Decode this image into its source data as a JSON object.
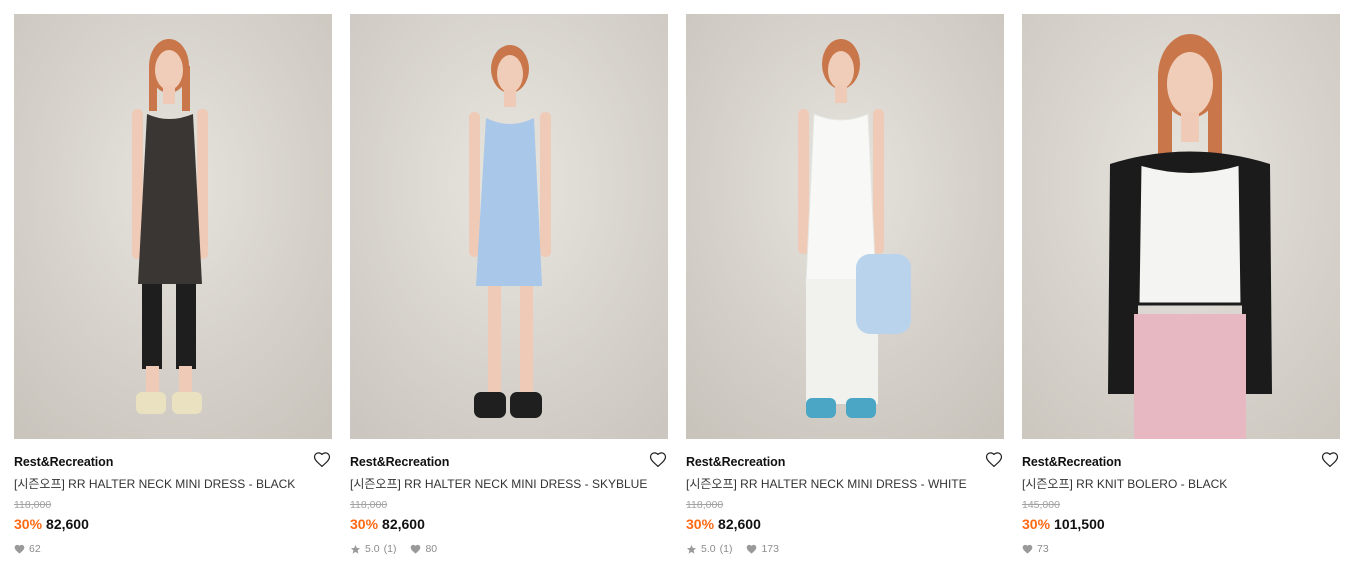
{
  "products": [
    {
      "brand": "Rest&Recreation",
      "name": "[시즌오프] RR HALTER NECK MINI DRESS - BLACK",
      "original_price": "118,000",
      "discount": "30%",
      "price": "82,600",
      "rating": "",
      "review_count": "",
      "likes": "62",
      "colors": {
        "garment": "#3a3633",
        "legs": "#1e1e1e",
        "shoes": "#e9e1bf"
      }
    },
    {
      "brand": "Rest&Recreation",
      "name": "[시즌오프] RR HALTER NECK MINI DRESS - SKYBLUE",
      "original_price": "118,000",
      "discount": "30%",
      "price": "82,600",
      "rating": "5.0",
      "review_count": "(1)",
      "likes": "80",
      "colors": {
        "garment": "#a9c7e8",
        "legs": "#e9c5b2",
        "shoes": "#1f1f1f"
      }
    },
    {
      "brand": "Rest&Recreation",
      "name": "[시즌오프] RR HALTER NECK MINI DRESS - WHITE",
      "original_price": "118,000",
      "discount": "30%",
      "price": "82,600",
      "rating": "5.0",
      "review_count": "(1)",
      "likes": "173",
      "colors": {
        "garment": "#f8f8f6",
        "legs": "#f1f1ee",
        "shoes": "#4aa6c4"
      }
    },
    {
      "brand": "Rest&Recreation",
      "name": "[시즌오프] RR KNIT BOLERO - BLACK",
      "original_price": "145,000",
      "discount": "30%",
      "price": "101,500",
      "rating": "",
      "review_count": "",
      "likes": "73",
      "colors": {
        "garment": "#1b1b1b",
        "legs": "#e8b8c2",
        "shoes": "#f4f4f2"
      }
    }
  ],
  "theme": {
    "discount_color": "#ff6a13",
    "backdrop_color": "#d9d5ce"
  }
}
